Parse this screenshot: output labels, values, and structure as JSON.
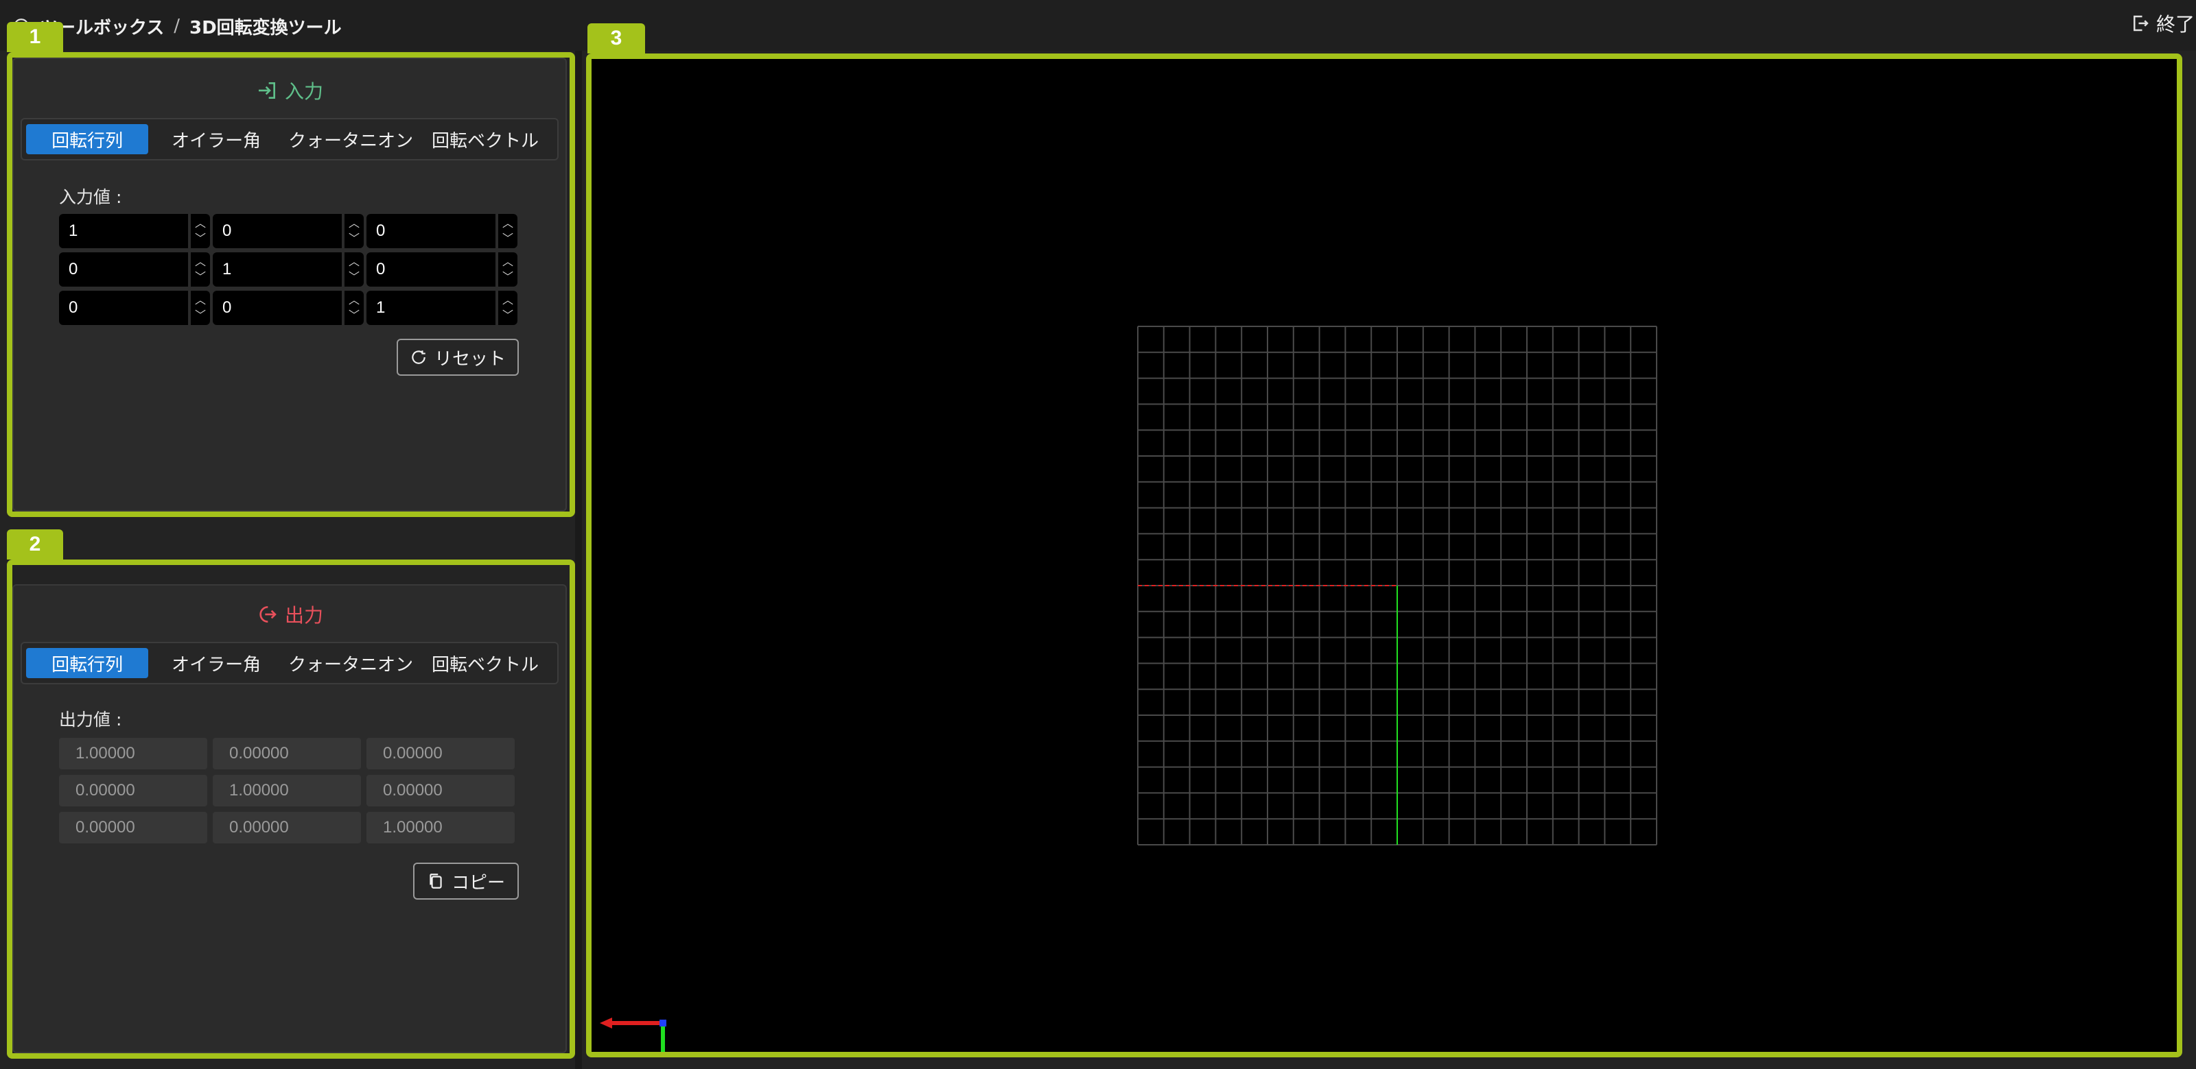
{
  "breadcrumb": {
    "root": "ツールボックス",
    "separator": "/",
    "current": "3D回転変換ツール"
  },
  "exit_label": "終了",
  "panels": {
    "input": {
      "tag": "1",
      "title": "入力",
      "tabs": [
        "回転行列",
        "オイラー角",
        "クォータニオン",
        "回転ベクトル"
      ],
      "active_tab": "回転行列",
      "value_label": "入力値 :",
      "matrix": [
        [
          "1",
          "0",
          "0"
        ],
        [
          "0",
          "1",
          "0"
        ],
        [
          "0",
          "0",
          "1"
        ]
      ],
      "reset_label": "リセット"
    },
    "output": {
      "tag": "2",
      "title": "出力",
      "tabs": [
        "回転行列",
        "オイラー角",
        "クォータニオン",
        "回転ベクトル"
      ],
      "active_tab": "回転行列",
      "value_label": "出力値 :",
      "matrix": [
        [
          "1.00000",
          "0.00000",
          "0.00000"
        ],
        [
          "0.00000",
          "1.00000",
          "0.00000"
        ],
        [
          "0.00000",
          "0.00000",
          "1.00000"
        ]
      ],
      "copy_label": "コピー"
    }
  },
  "viewport": {
    "tag": "3",
    "grid_divisions": 20,
    "colors": {
      "accent": "#a4c21b",
      "active_tab": "#1f7ad2",
      "grid": "#4a4a4a",
      "x_axis": "#e02020",
      "y_axis": "#20e020",
      "z_axis": "#2040ff",
      "input_title": "#5fbf8a",
      "output_title": "#e8505b"
    }
  }
}
